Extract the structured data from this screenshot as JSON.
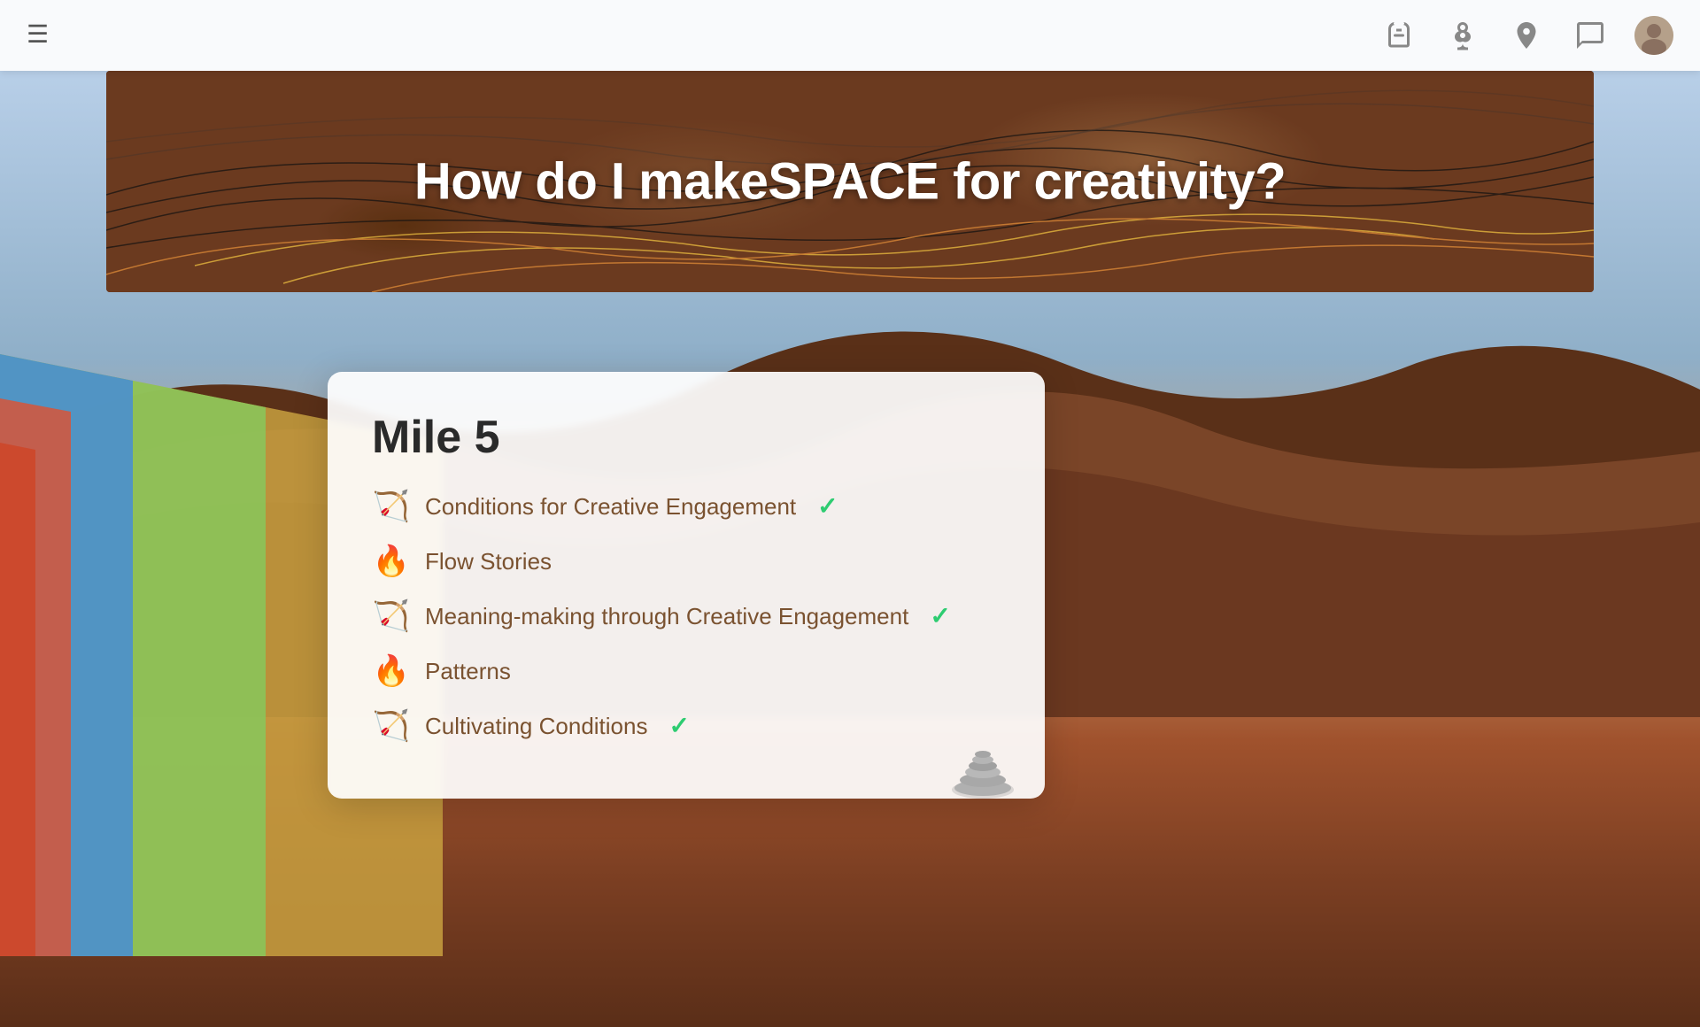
{
  "navbar": {
    "menu_icon": "☰",
    "icons": [
      {
        "name": "backpack-icon",
        "label": "Backpack"
      },
      {
        "name": "flower-icon",
        "label": "Flower"
      },
      {
        "name": "map-icon",
        "label": "Map"
      },
      {
        "name": "chat-icon",
        "label": "Chat"
      },
      {
        "name": "profile-icon",
        "label": "Profile"
      }
    ]
  },
  "banner": {
    "title": "How do I makeSPACE for creativity?"
  },
  "card": {
    "title": "Mile 5",
    "items": [
      {
        "label": "Conditions for Creative Engagement",
        "icon": "🏹",
        "completed": true
      },
      {
        "label": "Flow Stories",
        "icon": "🔥",
        "completed": false
      },
      {
        "label": "Meaning-making through Creative Engagement",
        "icon": "🏹",
        "completed": true
      },
      {
        "label": "Patterns",
        "icon": "🔥",
        "completed": false
      },
      {
        "label": "Cultivating Conditions",
        "icon": "🏹",
        "completed": true
      }
    ],
    "check_symbol": "✓"
  }
}
